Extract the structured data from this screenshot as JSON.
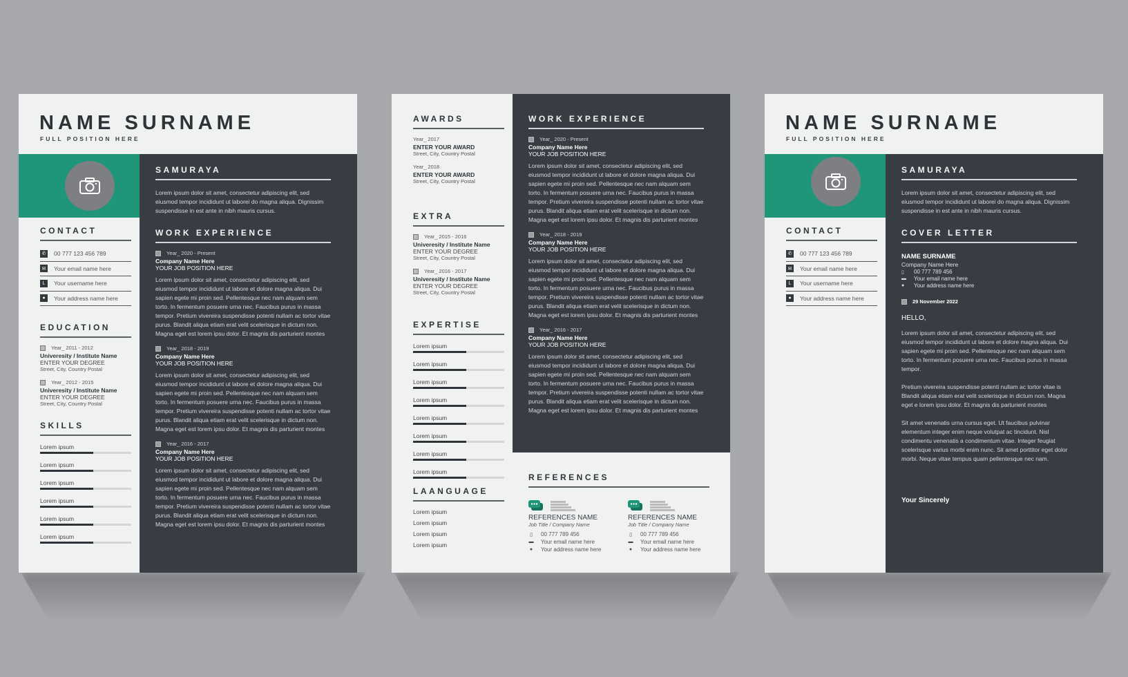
{
  "colors": {
    "accent": "#1f967a",
    "dark": "#383c43",
    "light": "#f0f1f1",
    "background": "#a7a8ac"
  },
  "resume1": {
    "name": "NAME SURNAME",
    "position": "FULL POSITION HERE",
    "photo_icon": "camera-icon",
    "contact": {
      "title": "CONTACT",
      "items": [
        {
          "icon": "phone-icon",
          "text": "00 777 123 456 789"
        },
        {
          "icon": "email-icon",
          "text": "Your email name here"
        },
        {
          "icon": "user-icon",
          "text": "Your username here"
        },
        {
          "icon": "location-icon",
          "text": "Your address name here"
        }
      ]
    },
    "education": {
      "title": "EDUCATION",
      "items": [
        {
          "year": "Year_ 2011 - 2012",
          "institute": "Univeresity / Institute Name",
          "degree": "ENTER YOUR DEGREE",
          "address": "Street, City, Country Postal"
        },
        {
          "year": "Year_ 2012 - 2015",
          "institute": "Univeresity / Institute Name",
          "degree": "ENTER YOUR DEGREE",
          "address": "Street, City, Country Postal"
        }
      ]
    },
    "skills": {
      "title": "SKILLS",
      "items": [
        {
          "label": "Lorem ipsum",
          "level": 0.58
        },
        {
          "label": "Lorem ipsum",
          "level": 0.58
        },
        {
          "label": "Lorem ipsum",
          "level": 0.58
        },
        {
          "label": "Lorem ipsum",
          "level": 0.58
        },
        {
          "label": "Lorem ipsum",
          "level": 0.58
        },
        {
          "label": "Lorem ipsum",
          "level": 0.58
        }
      ]
    },
    "profile": {
      "title": "SAMURAYA",
      "text": "Lorem ipsum dolor sit amet, consectetur adipiscing elit, sed eiusmod tempor incididunt ut laborei do magna aliqua. Dignissim suspendisse in est ante in nibh mauris cursus."
    },
    "work": {
      "title": "WORK EXPERIENCE",
      "items": [
        {
          "year": "Year_ 2020 - Present",
          "company": "Company Name Here",
          "position": "YOUR JOB POSITION HERE",
          "text": "Lorem ipsum dolor sit amet, consectetur adipiscing elit, sed eiusmod tempor incididunt ut labore et dolore magna aliqua. Dui sapien egete mi proin sed. Pellentesque nec nam alquam sem torto. In fermentum posuere urna nec. Faucibus purus in massa tempor. Pretium vivereira suspendisse potenti nullam ac tortor vitae purus. Blandit aliqua etiam erat velit scelerisque in dictum non. Magna eget est lorem ipsu dolor. Et magnis dis parturient montes"
        },
        {
          "year": "Year_ 2018 - 2019",
          "company": "Company Name Here",
          "position": "YOUR JOB POSITION HERE",
          "text": "Lorem ipsum dolor sit amet, consectetur adipiscing elit, sed eiusmod tempor incididunt ut labore et dolore magna aliqua. Dui sapien egete mi proin sed. Pellentesque nec nam alquam sem torto. In fermentum posuere urna nec. Faucibus purus in massa tempor. Pretium vivereira suspendisse potenti nullam ac tortor vitae purus. Blandit aliqua etiam erat velit scelerisque in dictum non. Magna eget est lorem ipsu dolor. Et magnis dis parturient montes"
        },
        {
          "year": "Year_ 2016 - 2017",
          "company": "Company Name Here",
          "position": "YOUR JOB POSITION HERE",
          "text": "Lorem ipsum dolor sit amet, consectetur adipiscing elit, sed eiusmod tempor incididunt ut labore et dolore magna aliqua. Dui sapien egete mi proin sed. Pellentesque nec nam alquam sem torto. In fermentum posuere urna nec. Faucibus purus in massa tempor. Pretium vivereira suspendisse potenti nullam ac tortor vitae purus. Blandit aliqua etiam erat velit scelerisque in dictum non. Magna eget est lorem ipsu dolor. Et magnis dis parturient montes"
        }
      ]
    }
  },
  "resume2": {
    "awards": {
      "title": "AWARDS",
      "items": [
        {
          "year": "Year_ 2017",
          "award": "ENTER YOUR AWARD",
          "address": "Street, City, Country Postal"
        },
        {
          "year": "Year_ 2018",
          "award": "ENTER YOUR AWARD",
          "address": "Street, City, Country Postal"
        }
      ]
    },
    "extra": {
      "title": "EXTRA",
      "items": [
        {
          "year": "Year_ 2015 - 2016",
          "institute": "Univeresity / Institute Name",
          "degree": "ENTER YOUR DEGREE",
          "address": "Street, City, Country Postal"
        },
        {
          "year": "Year_ 2016 - 2017",
          "institute": "Univeresity / Institute Name",
          "degree": "ENTER YOUR DEGREE",
          "address": "Street, City, Country Postal"
        }
      ]
    },
    "expertise": {
      "title": "EXPERTISE",
      "items": [
        {
          "label": "Lorem ipsum",
          "level": 0.58
        },
        {
          "label": "Lorem ipsum",
          "level": 0.58
        },
        {
          "label": "Lorem ipsum",
          "level": 0.58
        },
        {
          "label": "Lorem ipsum",
          "level": 0.58
        },
        {
          "label": "Lorem ipsum",
          "level": 0.58
        },
        {
          "label": "Lorem ipsum",
          "level": 0.58
        },
        {
          "label": "Lorem ipsum",
          "level": 0.58
        },
        {
          "label": "Lorem ipsum",
          "level": 0.58
        }
      ]
    },
    "language": {
      "title": "LAANGUAGE",
      "items": [
        "Lorem ipsum",
        "Lorem ipsum",
        "Lorem ipsum",
        "Lorem ipsum"
      ]
    },
    "work": {
      "title": "WORK EXPERIENCE",
      "items": [
        {
          "year": "Year_ 2020 - Present",
          "company": "Company Name Here",
          "position": "YOUR JOB POSITION HERE",
          "text": "Lorem ipsum dolor sit amet, consectetur adipiscing elit, sed eiusmod tempor incididunt ut labore et dolore magna aliqua. Dui sapien egete mi proin sed. Pellentesque nec nam alquam sem torto. In fermentum posuere urna nec. Faucibus purus in massa tempor. Pretium vivereira suspendisse potenti nullam ac tortor vitae purus. Blandit aliqua etiam erat velit scelerisque in dictum non. Magna eget est lorem ipsu dolor. Et magnis dis parturient montes"
        },
        {
          "year": "Year_ 2018 - 2019",
          "company": "Company Name Here",
          "position": "YOUR JOB POSITION HERE",
          "text": "Lorem ipsum dolor sit amet, consectetur adipiscing elit, sed eiusmod tempor incididunt ut labore et dolore magna aliqua. Dui sapien egete mi proin sed. Pellentesque nec nam alquam sem torto. In fermentum posuere urna nec. Faucibus purus in massa tempor. Pretium vivereira suspendisse potenti nullam ac tortor vitae purus. Blandit aliqua etiam erat velit scelerisque in dictum non. Magna eget est lorem ipsu dolor. Et magnis dis parturient montes"
        },
        {
          "year": "Year_ 2016 - 2017",
          "company": "Company Name Here",
          "position": "YOUR JOB POSITION HERE",
          "text": "Lorem ipsum dolor sit amet, consectetur adipiscing elit, sed eiusmod tempor incididunt ut labore et dolore magna aliqua. Dui sapien egete mi proin sed. Pellentesque nec nam alquam sem torto. In fermentum posuere urna nec. Faucibus purus in massa tempor. Pretium vivereira suspendisse potenti nullam ac tortor vitae purus. Blandit aliqua etiam erat velit scelerisque in dictum non. Magna eget est lorem ipsu dolor. Et magnis dis parturient montes"
        }
      ]
    },
    "references": {
      "title": "REFERENCES",
      "items": [
        {
          "name": "REFERENCES NAME",
          "job": "Job Title / Company Name",
          "phone": "00 777 789 456",
          "email": "Your email name here",
          "address": "Your address name here"
        },
        {
          "name": "REFERENCES NAME",
          "job": "Job Title / Company Name",
          "phone": "00 777 789 456",
          "email": "Your email name here",
          "address": "Your address name here"
        }
      ]
    }
  },
  "resume3": {
    "name": "NAME SURNAME",
    "position": "FULL POSITION HERE",
    "contact": {
      "title": "CONTACT",
      "items": [
        {
          "icon": "phone-icon",
          "text": "00 777 123 456 789"
        },
        {
          "icon": "email-icon",
          "text": "Your email name here"
        },
        {
          "icon": "user-icon",
          "text": "Your username here"
        },
        {
          "icon": "location-icon",
          "text": "Your address name here"
        }
      ]
    },
    "profile": {
      "title": "SAMURAYA",
      "text": "Lorem ipsum dolor sit amet, consectetur adipiscing elit, sed eiusmod tempor incididunt ut laborei do magna aliqua. Dignissim suspendisse in est ante in nibh mauris cursus."
    },
    "cover": {
      "title": "COVER LETTER",
      "name": "NAME SURNAME",
      "company": "Company Name Here",
      "phone": "00 777 789 456",
      "email": "Your email name here",
      "address": "Your address name here",
      "date": "29 November 2022",
      "greeting": "HELLO,",
      "paragraphs": [
        "Lorem ipsum dolor sit amet, consectetur adipiscing elit, sed eiusmod tempor incididunt ut labore et dolore magna aliqua. Dui sapien egete mi proin sed. Pellentesque nec nam aliquam sem torto. In fermentum posuere urna nec. Faucibus purus in massa tempor.",
        "Pretium vivereira suspendisse potenti nullam ac tortor vitae is Blandit aliqua etiam erat velit scelerisque in dictum non. Magna eget e lorem ipsu dolor. Et magnis dis parturient montes",
        "Sit amet venenatis urna cursus eget. Ut faucibus pulvinar elementum integer enim neque volutpat ac tincidunt. Nisl condimentu  venenatis a condimentum vitae. Integer feugiat scelerisque varius morbi enim nunc. Sit amet porttitor eget dolor morbi. Neque vitae tempus quam pellentesque nec nam."
      ],
      "closing": "Your Sincerely"
    }
  }
}
